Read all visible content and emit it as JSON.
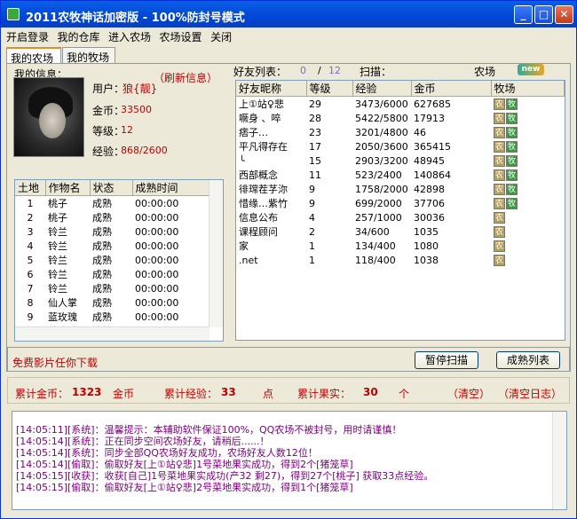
{
  "window": {
    "title": "2011农牧神话加密版  -  100%防封号模式"
  },
  "menu": [
    "开启登录",
    "我的仓库",
    "进入农场",
    "农场设置",
    "关闭"
  ],
  "tabs": [
    "我的农场",
    "我的牧场"
  ],
  "my_info": {
    "header": "我的信息：",
    "refresh": "（刷新信息）",
    "user_label": "用户：",
    "user_value": "狼{靓}",
    "gold_label": "金币：",
    "gold_value": "33500",
    "level_label": "等级：",
    "level_value": "12",
    "exp_label": "经验：",
    "exp_value": "868/2600"
  },
  "friends_bar": {
    "label": "好友列表：",
    "count_a": "0",
    "sep": "/",
    "count_b": "12",
    "scan_label": "扫描：",
    "farm_label": "农场",
    "new_badge": "new"
  },
  "land_grid": {
    "columns": [
      "土地",
      "作物名",
      "状态",
      "成熟时间"
    ],
    "rows": [
      [
        "1",
        "桃子",
        "成熟",
        "00:00:00"
      ],
      [
        "2",
        "桃子",
        "成熟",
        "00:00:00"
      ],
      [
        "3",
        "铃兰",
        "成熟",
        "00:00:00"
      ],
      [
        "4",
        "铃兰",
        "成熟",
        "00:00:00"
      ],
      [
        "5",
        "铃兰",
        "成熟",
        "00:00:00"
      ],
      [
        "6",
        "铃兰",
        "成熟",
        "00:00:00"
      ],
      [
        "7",
        "铃兰",
        "成熟",
        "00:00:00"
      ],
      [
        "8",
        "仙人掌",
        "成熟",
        "00:00:00"
      ],
      [
        "9",
        "蓝玫瑰",
        "成熟",
        "00:00:00"
      ],
      [
        "10",
        "蓝玫瑰",
        "成熟",
        "00:00:00"
      ]
    ]
  },
  "friend_grid": {
    "columns": [
      "好友昵称",
      "等级",
      "经验",
      "金币",
      "牧场"
    ],
    "rows": [
      {
        "name": "上①站♀悲",
        "level": "29",
        "exp": "3473/6000",
        "gold": "627685",
        "farm": "农",
        "ranch": "牧"
      },
      {
        "name": "噘身 、啐",
        "level": "28",
        "exp": "5422/5800",
        "gold": "17913",
        "farm": "农",
        "ranch": "牧"
      },
      {
        "name": "痞子…",
        "level": "23",
        "exp": "3201/4800",
        "gold": "46",
        "farm": "农",
        "ranch": "牧"
      },
      {
        "name": "平凡得存在",
        "level": "17",
        "exp": "2050/3600",
        "gold": "365415",
        "farm": "农",
        "ranch": "牧"
      },
      {
        "name": "╰",
        "level": "15",
        "exp": "2903/3200",
        "gold": "48945",
        "farm": "农",
        "ranch": "牧"
      },
      {
        "name": "西部概念",
        "level": "11",
        "exp": "523/2400",
        "gold": "140864",
        "farm": "农",
        "ranch": "牧"
      },
      {
        "name": "徘瑺茬芓沵",
        "level": "9",
        "exp": "1758/2000",
        "gold": "42898",
        "farm": "农",
        "ranch": "牧"
      },
      {
        "name": "惜缘…紫竹",
        "level": "9",
        "exp": "699/2000",
        "gold": "37706",
        "farm": "农",
        "ranch": "牧"
      },
      {
        "name": "信息公布",
        "level": "4",
        "exp": "257/1000",
        "gold": "30036",
        "farm": "农",
        "ranch": ""
      },
      {
        "name": "课程顾问",
        "level": "2",
        "exp": "34/600",
        "gold": "1035",
        "farm": "农",
        "ranch": ""
      },
      {
        "name": "家",
        "level": "1",
        "exp": "134/400",
        "gold": "1080",
        "farm": "农",
        "ranch": ""
      },
      {
        "name": ".net",
        "level": "1",
        "exp": "118/400",
        "gold": "1038",
        "farm": "农",
        "ranch": ""
      }
    ]
  },
  "action_bar": {
    "download_text": "免费影片任你下载",
    "pause_button": "暂停扫描",
    "mature_button": "成熟列表"
  },
  "stats": {
    "gold_label": "累计金币：",
    "gold_value": "1323",
    "gold_unit": "金币",
    "exp_label": "累计经验：",
    "exp_value": "33",
    "exp_unit": "点",
    "fruit_label": "累计果实：",
    "fruit_value": "30",
    "fruit_unit": "个",
    "clear": "（清空）",
    "clear_log": "（清空日志）"
  },
  "log": [
    "[14:05:11][系统]：温馨提示：本辅助软件保证100%，QQ农场不被封号，用时请谨慎！",
    "[14:05:14][系统]：正在同步空间农场好友，请稍后......！",
    "[14:05:14][系统]：同步全部QQ农场好友成功，农场好友人数12位！",
    "[14:05:14][偷取]：偷取好友[上①站♀悲]1号菜地果实成功，得到2个[猪笼草]",
    "[14:05:15][收获]：收获[自己]1号菜地果实成功(产32 剩27)，得到27个[桃子] 获取33点经验。",
    "[14:05:15][偷取]：偷取好友[上①站♀悲]2号菜地果实成功，得到1个[猪笼草]"
  ],
  "colors": {
    "title_bar": "#0a5fe6",
    "accent_red": "#c00000",
    "log_text": "#800080",
    "body_bg": "#ece9d8"
  }
}
